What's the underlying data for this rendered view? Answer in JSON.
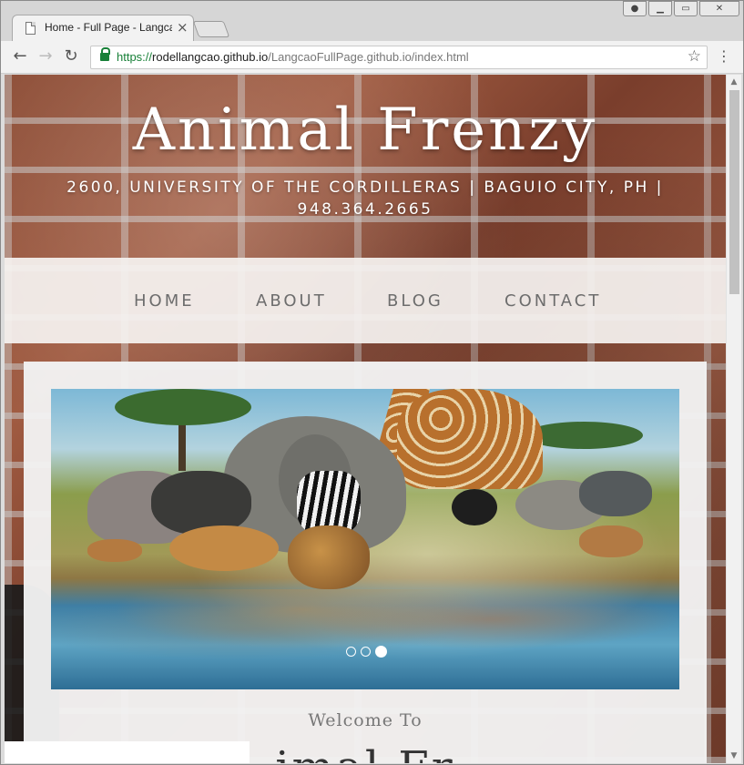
{
  "browser": {
    "tab_title": "Home - Full Page - LangcaoFullPage",
    "tab_close": "×",
    "url_scheme": "https://",
    "url_host": "rodellangcao.github.io",
    "url_path": "/LangcaoFullPage.github.io/index.html",
    "back_icon": "←",
    "forward_icon": "→",
    "reload_icon": "↻",
    "star_icon": "☆",
    "menu_icon": "⋮",
    "win_user_icon": "👤",
    "win_min": "▁",
    "win_max": "▭",
    "win_close": "✕"
  },
  "site": {
    "title": "Animal Frenzy",
    "address": "2600, UNIVERSITY OF THE CORDILLERAS | BAGUIO CITY, PH | 948.364.2665",
    "nav": [
      "HOME",
      "ABOUT",
      "BLOG",
      "CONTACT"
    ],
    "welcome": "Welcome To",
    "big_title_partial": "imal Fr"
  },
  "slider": {
    "slide_count": 3,
    "active_slide": 3
  },
  "colors": {
    "accent_lock": "#188038",
    "nav_text": "#6d6d6d"
  }
}
